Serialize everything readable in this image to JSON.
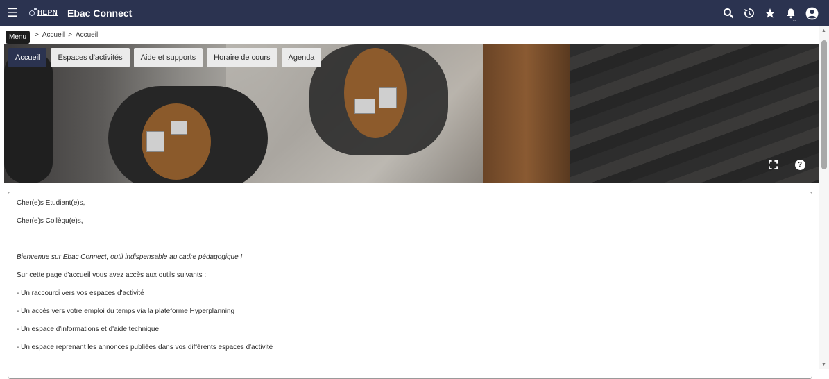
{
  "topbar": {
    "menu_icon": "hamburger-icon",
    "logo_text": "HEPN",
    "app_title": "Ebac Connect",
    "icons": [
      "search-icon",
      "history-icon",
      "star-icon",
      "bell-icon",
      "user-icon"
    ],
    "bell_badge": "...",
    "background": "#2b3350"
  },
  "tooltip": {
    "text": "Menu"
  },
  "breadcrumb": {
    "items": [
      "Accueil",
      "Accueil"
    ],
    "separator": ">"
  },
  "tabs": [
    {
      "label": "Accueil",
      "active": true
    },
    {
      "label": "Espaces d'activités",
      "active": false
    },
    {
      "label": "Aide et supports",
      "active": false
    },
    {
      "label": "Horaire de cours",
      "active": false
    },
    {
      "label": "Agenda",
      "active": false
    }
  ],
  "banner": {
    "fullscreen_icon": "fullscreen-icon",
    "help_icon": "help-icon",
    "help_glyph": "?"
  },
  "content": {
    "greeting_students": "Cher(e)s Etudiant(e)s,",
    "greeting_colleagues": "Cher(e)s Collègu(e)s,",
    "welcome": "Bienvenue sur Ebac Connect, outil indispensable au cadre pédagogique !",
    "intro": "Sur cette page d'accueil vous avez accès aux outils suivants :",
    "items": [
      "- Un raccourci vers vos espaces d'activité",
      "- Un accès vers votre emploi du temps via la plateforme Hyperplanning",
      "- Un espace d'informations et d'aide technique",
      "- Un espace reprenant les annonces publiées dans vos différents espaces d'activité"
    ]
  }
}
